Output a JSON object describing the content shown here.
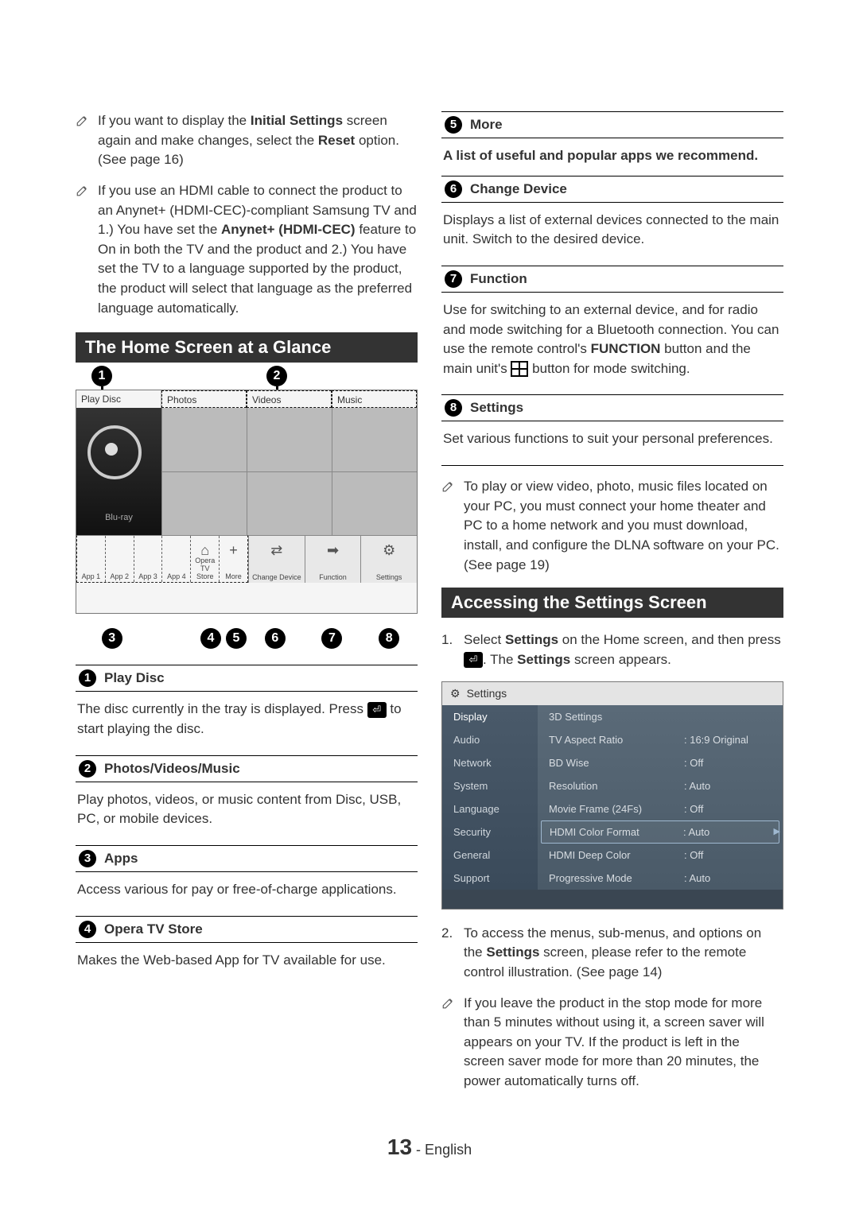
{
  "left": {
    "notes": [
      {
        "pre": "If you want to display the ",
        "b1": "Initial Settings",
        "mid": " screen again and make changes, select the ",
        "b2": "Reset",
        "post": " option. (See page 16)"
      },
      {
        "text": "If you use an HDMI cable to connect the product to an Anynet+ (HDMI-CEC)-compliant Samsung TV and 1.) You have set the ",
        "b1": "Anynet+ (HDMI-CEC)",
        "mid": " feature to On in both the TV and the product and 2.) You have set the TV to a language supported by the product, the product will select that language as the preferred language automatically."
      }
    ],
    "section": "The Home Screen at a Glance",
    "hs": {
      "topCells": [
        "Play Disc",
        "Photos",
        "Videos",
        "Music"
      ],
      "bluray": "Blu-ray",
      "apps": [
        "App 1",
        "App 2",
        "App 3",
        "App 4",
        "Opera TV Store",
        "More"
      ],
      "rightIcons": [
        "Change Device",
        "Function",
        "Settings"
      ]
    },
    "defs": [
      {
        "n": "1",
        "title": "Play Disc",
        "body": "The disc currently in the tray is displayed. Press ",
        "badge": "⏎",
        "body2": " to start playing the disc."
      },
      {
        "n": "2",
        "title": "Photos/Videos/Music",
        "body": "Play photos, videos, or music content from Disc, USB, PC, or mobile devices."
      },
      {
        "n": "3",
        "title": "Apps",
        "body": "Access various for pay or free-of-charge applications."
      },
      {
        "n": "4",
        "title": "Opera TV Store",
        "body": "Makes the Web-based App for TV available for use."
      }
    ]
  },
  "right": {
    "defs": [
      {
        "n": "5",
        "title": "More",
        "body": "A list of useful and popular apps we recommend.",
        "bold": true
      },
      {
        "n": "6",
        "title": "Change Device",
        "body": "Displays a list of external devices connected to the main unit. Switch to the desired device."
      },
      {
        "n": "7",
        "title": "Function",
        "body": "Use for switching to an external device, and for radio and mode switching for a Bluetooth connection. You can use the remote control's ",
        "b1": "FUNCTION",
        "mid": " button and the main unit's ",
        "grid": true,
        "post": " button for mode switching."
      },
      {
        "n": "8",
        "title": "Settings",
        "body": "Set various functions to suit your personal preferences."
      }
    ],
    "noteDlna": "To play or view video, photo, music files located on your PC, you must connect your home theater and PC to a home network and you must download, install, and configure the DLNA software on your PC. (See page 19)",
    "section2": "Accessing the Settings Screen",
    "step1": {
      "pre": "Select ",
      "b1": "Settings",
      "mid": " on the Home screen, and then press ",
      "badge": "⏎",
      "mid2": ". The ",
      "b2": "Settings",
      "post": " screen appears."
    },
    "settingsShot": {
      "title": "Settings",
      "menu": [
        "Display",
        "Audio",
        "Network",
        "System",
        "Language",
        "Security",
        "General",
        "Support"
      ],
      "rows": [
        {
          "label": "3D Settings",
          "val": ""
        },
        {
          "label": "TV Aspect Ratio",
          "val": ": 16:9 Original"
        },
        {
          "label": "BD Wise",
          "val": ": Off"
        },
        {
          "label": "Resolution",
          "val": ": Auto"
        },
        {
          "label": "Movie Frame (24Fs)",
          "val": ": Off"
        },
        {
          "label": "HDMI Color Format",
          "val": ": Auto",
          "selected": true
        },
        {
          "label": "HDMI Deep Color",
          "val": ": Off"
        },
        {
          "label": "Progressive Mode",
          "val": ": Auto"
        }
      ]
    },
    "step2": {
      "pre": "To access the menus, sub-menus, and options on the ",
      "b1": "Settings",
      "post": " screen, please refer to the remote control illustration. (See page 14)"
    },
    "noteSaver": "If you leave the product in the stop mode for more than 5 minutes without using it, a screen saver will appears on your TV. If the product is left in the screen saver mode for more than 20 minutes, the power automatically turns off."
  },
  "footer": {
    "page": "13",
    "lang": "English"
  }
}
